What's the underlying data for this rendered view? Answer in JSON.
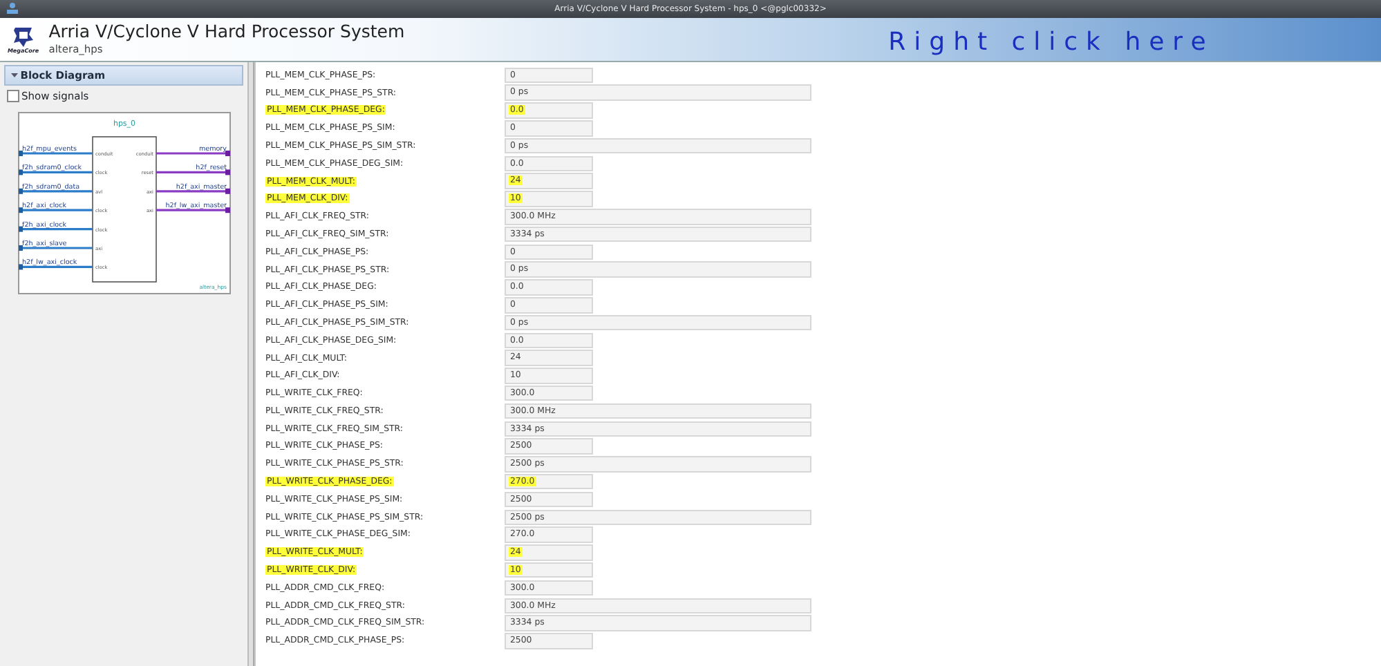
{
  "window": {
    "title": "Arria V/Cyclone V Hard Processor System - hps_0 <@pglc00332>"
  },
  "header": {
    "title": "Arria V/Cyclone V Hard Processor System",
    "subtitle": "altera_hps",
    "logo_caption": "MegaCore",
    "annotation": "Right click here"
  },
  "block_diagram": {
    "title": "Block Diagram",
    "expanded": true,
    "show_signals": {
      "label": "Show signals",
      "checked": false
    },
    "component": {
      "name": "hps_0",
      "type_label": "altera_hps",
      "left_ports": [
        {
          "signal": "h2f_mpu_events",
          "port": "conduit"
        },
        {
          "signal": "f2h_sdram0_clock",
          "port": "clock"
        },
        {
          "signal": "f2h_sdram0_data",
          "port": "avl"
        },
        {
          "signal": "h2f_axi_clock",
          "port": "clock"
        },
        {
          "signal": "f2h_axi_clock",
          "port": "clock"
        },
        {
          "signal": "f2h_axi_slave",
          "port": "axi"
        },
        {
          "signal": "h2f_lw_axi_clock",
          "port": "clock"
        }
      ],
      "right_ports": [
        {
          "signal": "memory",
          "port": "conduit"
        },
        {
          "signal": "h2f_reset",
          "port": "reset"
        },
        {
          "signal": "h2f_axi_master",
          "port": "axi"
        },
        {
          "signal": "h2f_lw_axi_master",
          "port": "axi"
        }
      ]
    }
  },
  "parameters": [
    {
      "label": "PLL_MEM_CLK_PHASE_PS:",
      "value": "0",
      "kind": "short",
      "highlighted": false
    },
    {
      "label": "PLL_MEM_CLK_PHASE_PS_STR:",
      "value": "0 ps",
      "kind": "wide",
      "highlighted": false
    },
    {
      "label": "PLL_MEM_CLK_PHASE_DEG:",
      "value": "0.0",
      "kind": "short",
      "highlighted": true
    },
    {
      "label": "PLL_MEM_CLK_PHASE_PS_SIM:",
      "value": "0",
      "kind": "short",
      "highlighted": false
    },
    {
      "label": "PLL_MEM_CLK_PHASE_PS_SIM_STR:",
      "value": "0 ps",
      "kind": "wide",
      "highlighted": false
    },
    {
      "label": "PLL_MEM_CLK_PHASE_DEG_SIM:",
      "value": "0.0",
      "kind": "short",
      "highlighted": false
    },
    {
      "label": "PLL_MEM_CLK_MULT:",
      "value": "24",
      "kind": "short",
      "highlighted": true
    },
    {
      "label": "PLL_MEM_CLK_DIV:",
      "value": "10",
      "kind": "short",
      "highlighted": true
    },
    {
      "label": "PLL_AFI_CLK_FREQ_STR:",
      "value": "300.0 MHz",
      "kind": "wide",
      "highlighted": false
    },
    {
      "label": "PLL_AFI_CLK_FREQ_SIM_STR:",
      "value": "3334 ps",
      "kind": "wide",
      "highlighted": false
    },
    {
      "label": "PLL_AFI_CLK_PHASE_PS:",
      "value": "0",
      "kind": "short",
      "highlighted": false
    },
    {
      "label": "PLL_AFI_CLK_PHASE_PS_STR:",
      "value": "0 ps",
      "kind": "wide",
      "highlighted": false
    },
    {
      "label": "PLL_AFI_CLK_PHASE_DEG:",
      "value": "0.0",
      "kind": "short",
      "highlighted": false
    },
    {
      "label": "PLL_AFI_CLK_PHASE_PS_SIM:",
      "value": "0",
      "kind": "short",
      "highlighted": false
    },
    {
      "label": "PLL_AFI_CLK_PHASE_PS_SIM_STR:",
      "value": "0 ps",
      "kind": "wide",
      "highlighted": false
    },
    {
      "label": "PLL_AFI_CLK_PHASE_DEG_SIM:",
      "value": "0.0",
      "kind": "short",
      "highlighted": false
    },
    {
      "label": "PLL_AFI_CLK_MULT:",
      "value": "24",
      "kind": "short",
      "highlighted": false
    },
    {
      "label": "PLL_AFI_CLK_DIV:",
      "value": "10",
      "kind": "short",
      "highlighted": false
    },
    {
      "label": "PLL_WRITE_CLK_FREQ:",
      "value": "300.0",
      "kind": "short",
      "highlighted": false
    },
    {
      "label": "PLL_WRITE_CLK_FREQ_STR:",
      "value": "300.0 MHz",
      "kind": "wide",
      "highlighted": false
    },
    {
      "label": "PLL_WRITE_CLK_FREQ_SIM_STR:",
      "value": "3334 ps",
      "kind": "wide",
      "highlighted": false
    },
    {
      "label": "PLL_WRITE_CLK_PHASE_PS:",
      "value": "2500",
      "kind": "short",
      "highlighted": false
    },
    {
      "label": "PLL_WRITE_CLK_PHASE_PS_STR:",
      "value": "2500 ps",
      "kind": "wide",
      "highlighted": false
    },
    {
      "label": "PLL_WRITE_CLK_PHASE_DEG:",
      "value": "270.0",
      "kind": "short",
      "highlighted": true
    },
    {
      "label": "PLL_WRITE_CLK_PHASE_PS_SIM:",
      "value": "2500",
      "kind": "short",
      "highlighted": false
    },
    {
      "label": "PLL_WRITE_CLK_PHASE_PS_SIM_STR:",
      "value": "2500 ps",
      "kind": "wide",
      "highlighted": false
    },
    {
      "label": "PLL_WRITE_CLK_PHASE_DEG_SIM:",
      "value": "270.0",
      "kind": "short",
      "highlighted": false
    },
    {
      "label": "PLL_WRITE_CLK_MULT:",
      "value": "24",
      "kind": "short",
      "highlighted": true
    },
    {
      "label": "PLL_WRITE_CLK_DIV:",
      "value": "10",
      "kind": "short",
      "highlighted": true
    },
    {
      "label": "PLL_ADDR_CMD_CLK_FREQ:",
      "value": "300.0",
      "kind": "short",
      "highlighted": false
    },
    {
      "label": "PLL_ADDR_CMD_CLK_FREQ_STR:",
      "value": "300.0 MHz",
      "kind": "wide",
      "highlighted": false
    },
    {
      "label": "PLL_ADDR_CMD_CLK_FREQ_SIM_STR:",
      "value": "3334 ps",
      "kind": "wide",
      "highlighted": false
    },
    {
      "label": "PLL_ADDR_CMD_CLK_PHASE_PS:",
      "value": "2500",
      "kind": "short",
      "highlighted": false
    }
  ]
}
